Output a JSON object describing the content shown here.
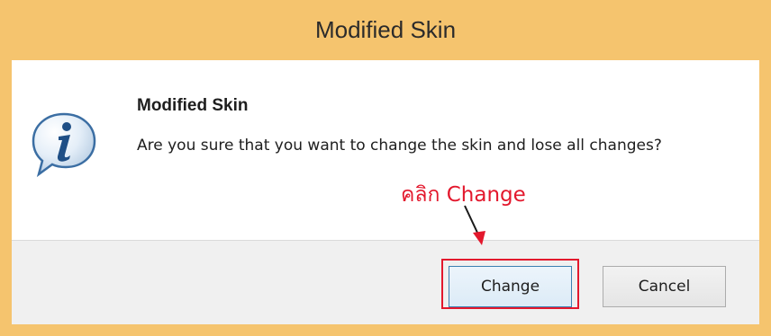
{
  "window": {
    "title": "Modified Skin",
    "frame_color": "#f5c46e"
  },
  "dialog": {
    "icon": "info-speech-bubble-icon",
    "heading": "Modified Skin",
    "message": "Are you sure that you want to change the skin and lose all changes?"
  },
  "buttons": {
    "change_label": "Change",
    "cancel_label": "Cancel"
  },
  "annotation": {
    "text": "คลิก Change",
    "color": "#e3182d"
  }
}
